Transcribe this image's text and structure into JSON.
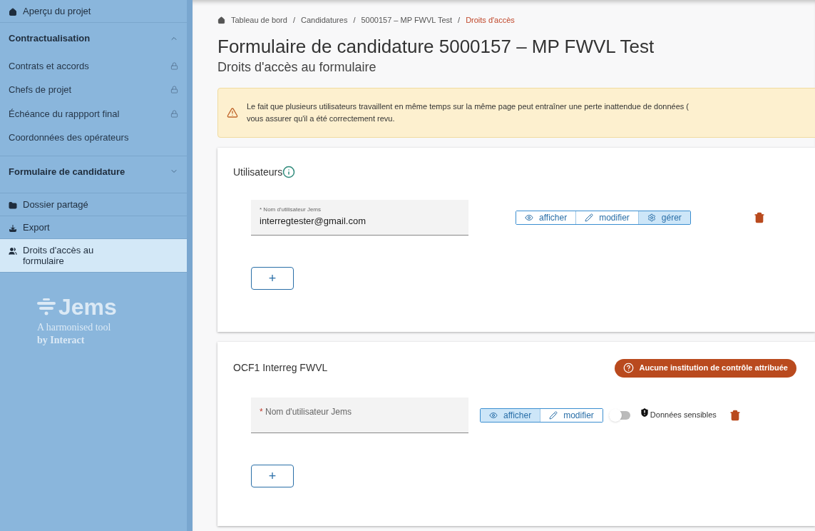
{
  "sidebar": {
    "items": [
      {
        "kind": "link",
        "label": "Aperçu du projet",
        "selected": false
      },
      {
        "kind": "section",
        "label": "Contractualisation",
        "expanded": true,
        "children": [
          {
            "label": "Contrats et accords",
            "locked": true
          },
          {
            "label": "Chefs de projet",
            "locked": true
          },
          {
            "label": "Échéance du rappport final",
            "locked": true
          },
          {
            "label": "Coordonnées des opérateurs",
            "locked": false
          }
        ]
      },
      {
        "kind": "section",
        "label": "Formulaire de candidature",
        "expanded": false
      },
      {
        "kind": "link",
        "label": "Dossier partagé",
        "selected": false
      },
      {
        "kind": "link",
        "label": "Export",
        "selected": false
      },
      {
        "kind": "link",
        "label": "Droits d'accès au formulaire",
        "selected": true
      }
    ],
    "logo": {
      "name": "Jems",
      "tagline_1": "A harmonised tool",
      "tagline_2": "by Interact"
    }
  },
  "breadcrumb": {
    "separator": "/",
    "items": [
      "Tableau de bord",
      "Candidatures",
      "5000157 – MP FWVL Test",
      "Droits d'accès"
    ]
  },
  "title": "Formulaire de candidature 5000157 – MP FWVL Test",
  "subtitle": "Droits d'accès au formulaire",
  "warning": "Le fait que plusieurs utilisateurs travaillent en même temps sur la même page peut entraîner une perte inattendue de données (",
  "warning_line_2": "vous assurer qu'il a été correctement revu.",
  "cards": [
    {
      "title": "Utilisateurs",
      "info_icon": true,
      "users": [
        {
          "required_mark": "*",
          "field_label": "Nom d'utilisateur Jems",
          "value": "interregtester@gmail.com",
          "permissions": [
            {
              "label": "afficher",
              "selected": false
            },
            {
              "label": "modifier",
              "selected": false
            },
            {
              "label": "gérer",
              "selected": true
            }
          ]
        }
      ],
      "add": "+"
    },
    {
      "title": "OCF1 Interreg FWVL",
      "info_icon": false,
      "badge": "Aucune institution de contrôle attribuée",
      "users": [
        {
          "required_mark": "*",
          "placeholder": "Nom d'utilisateur Jems",
          "permissions": [
            {
              "label": "afficher",
              "selected": true
            },
            {
              "label": "modifier",
              "selected": false
            }
          ],
          "sensitive": {
            "on": false,
            "label": "Données sensibles"
          }
        }
      ],
      "add": "+"
    }
  ]
}
